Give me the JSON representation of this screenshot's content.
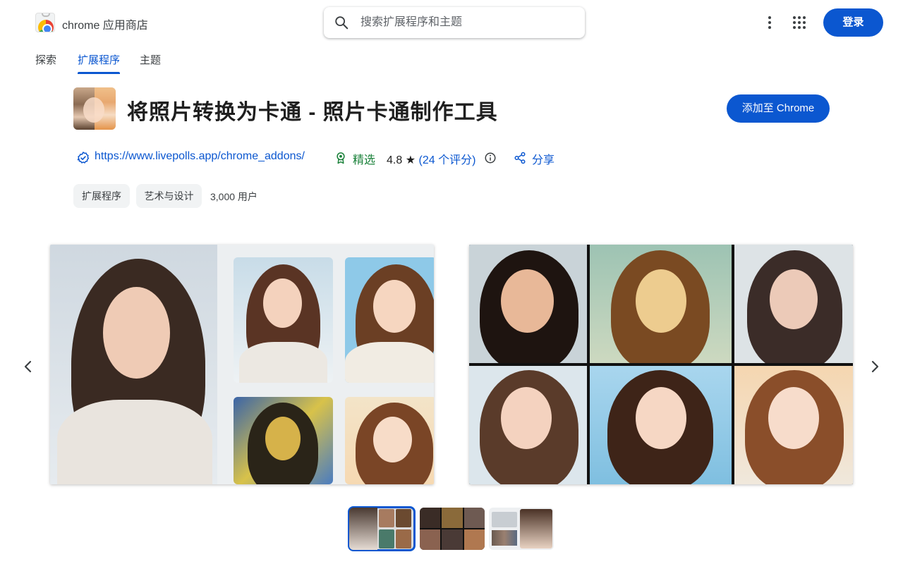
{
  "header": {
    "brand": "chrome 应用商店",
    "search_placeholder": "搜索扩展程序和主题",
    "login_label": "登录"
  },
  "tabs": [
    {
      "label": "探索",
      "active": false
    },
    {
      "label": "扩展程序",
      "active": true
    },
    {
      "label": "主题",
      "active": false
    }
  ],
  "item": {
    "title": "将照片转换为卡通 - 照片卡通制作工具",
    "add_button": "添加至 Chrome",
    "website": "https://www.livepolls.app/chrome_addons/",
    "featured_label": "精选",
    "rating": "4.8",
    "rating_count_text": "(24 个评分)",
    "share_label": "分享",
    "categories": [
      "扩展程序",
      "艺术与设计"
    ],
    "users": "3,000 用户"
  },
  "carousel": {
    "active_index": 0,
    "thumbnail_count": 3
  },
  "colors": {
    "accent": "#0b57d0",
    "featured": "#188038"
  }
}
